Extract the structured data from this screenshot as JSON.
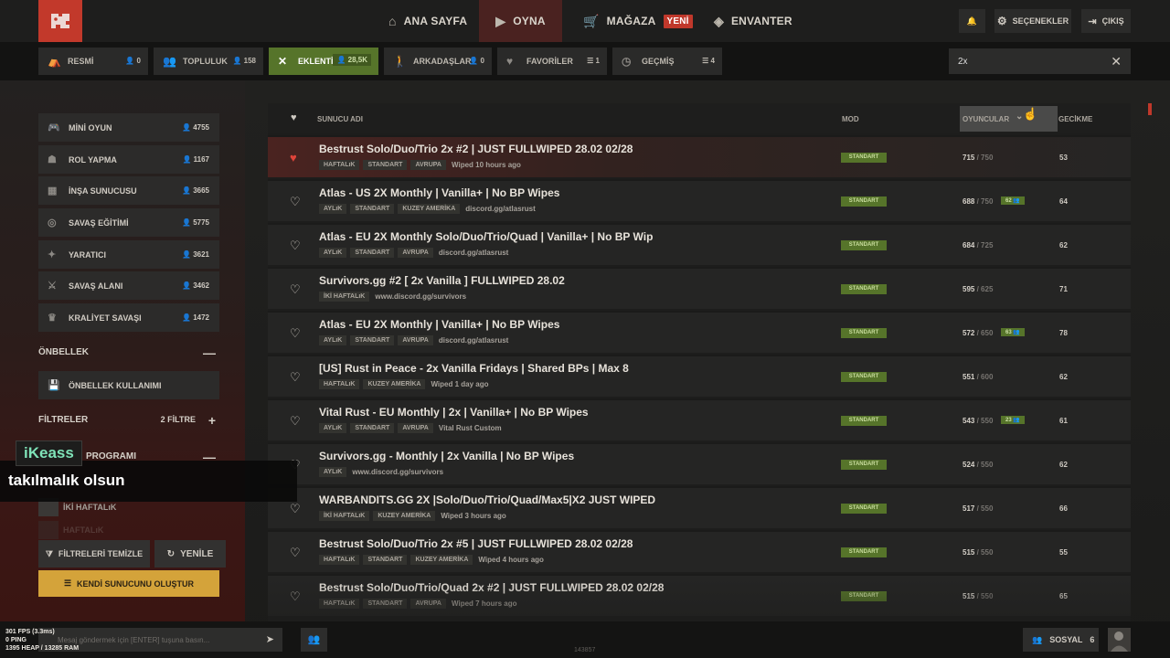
{
  "nav": {
    "home": "ANA SAYFA",
    "play": "OYNA",
    "store": "MAĞAZA",
    "store_badge": "YENİ",
    "inventory": "ENVANTER",
    "options": "SEÇENEKLER",
    "quit": "ÇIKIŞ"
  },
  "tabs": [
    {
      "label": "RESMİ",
      "count": "0",
      "icon": "official-icon"
    },
    {
      "label": "TOPLULUK",
      "count": "158",
      "icon": "community-icon"
    },
    {
      "label": "EKLENTİLİ",
      "count": "28,5K",
      "icon": "modded-icon"
    },
    {
      "label": "ARKADAŞLAR",
      "count": "0",
      "icon": "friends-icon"
    },
    {
      "label": "FAVORİLER",
      "count": "1",
      "icon": "heart-icon"
    },
    {
      "label": "GEÇMİŞ",
      "count": "4",
      "icon": "history-icon"
    }
  ],
  "search": {
    "value": "2x"
  },
  "gamemodes": [
    {
      "label": "MİNİ OYUN",
      "count": "4755"
    },
    {
      "label": "ROL YAPMA",
      "count": "1167"
    },
    {
      "label": "İNŞA SUNUCUSU",
      "count": "3665"
    },
    {
      "label": "SAVAŞ EĞİTİMİ",
      "count": "5775"
    },
    {
      "label": "YARATICI",
      "count": "3621"
    },
    {
      "label": "SAVAŞ ALANI",
      "count": "3462"
    },
    {
      "label": "KRALİYET SAVAŞI",
      "count": "1472"
    }
  ],
  "cache": {
    "title": "ÖNBELLEK",
    "button": "ÖNBELLEK KULLANIMI"
  },
  "filters": {
    "title": "FİLTRELER",
    "count": "2 FİLTRE",
    "wipe_title": "PROGRAMI",
    "opt1": "İKİ HAFTALıK",
    "opt2": "HAFTALıK"
  },
  "actions": {
    "clear": "FİLTRELERİ TEMİZLE",
    "refresh": "YENİLE",
    "create": "KENDİ SUNUCUNU OLUŞTUR"
  },
  "columns": {
    "name": "SUNUCU ADI",
    "mode": "MOD",
    "players": "OYUNCULAR",
    "ping": "GECİKME"
  },
  "servers": [
    {
      "name": "Bestrust Solo/Duo/Trio 2x #2 | JUST FULLWIPED 28.02 02/28",
      "tags": [
        "HAFTALıK",
        "STANDART",
        "AVRUPA"
      ],
      "extra": "Wiped 10 hours ago",
      "mode": "STANDART",
      "players": "715",
      "max": "/ 750",
      "queue": "",
      "ping": "53",
      "fav": true
    },
    {
      "name": "Atlas - US 2X Monthly | Vanilla+ | No BP Wipes",
      "tags": [
        "AYLıK",
        "STANDART",
        "KUZEY AMERİKA"
      ],
      "extra": "discord.gg/atlasrust",
      "mode": "STANDART",
      "players": "688",
      "max": "/ 750",
      "queue": "62",
      "ping": "64",
      "fav": false
    },
    {
      "name": "Atlas - EU 2X Monthly Solo/Duo/Trio/Quad | Vanilla+ | No BP Wip",
      "tags": [
        "AYLıK",
        "STANDART",
        "AVRUPA"
      ],
      "extra": "discord.gg/atlasrust",
      "mode": "STANDART",
      "players": "684",
      "max": "/ 725",
      "queue": "",
      "ping": "62",
      "fav": false
    },
    {
      "name": "Survivors.gg #2 [ 2x Vanilla ] FULLWIPED 28.02",
      "tags": [
        "İKİ HAFTALıK"
      ],
      "extra": "www.discord.gg/survivors",
      "mode": "STANDART",
      "players": "595",
      "max": "/ 625",
      "queue": "",
      "ping": "71",
      "fav": false
    },
    {
      "name": "Atlas - EU 2X Monthly | Vanilla+ | No BP Wipes",
      "tags": [
        "AYLıK",
        "STANDART",
        "AVRUPA"
      ],
      "extra": "discord.gg/atlasrust",
      "mode": "STANDART",
      "players": "572",
      "max": "/ 650",
      "queue": "63",
      "ping": "78",
      "fav": false
    },
    {
      "name": "[US] Rust in Peace - 2x Vanilla Fridays | Shared BPs | Max 8",
      "tags": [
        "HAFTALıK",
        "KUZEY AMERİKA"
      ],
      "extra": "Wiped 1 day ago",
      "mode": "STANDART",
      "players": "551",
      "max": "/ 600",
      "queue": "",
      "ping": "62",
      "fav": false
    },
    {
      "name": "Vital Rust - EU Monthly | 2x | Vanilla+ | No BP Wipes",
      "tags": [
        "AYLıK",
        "STANDART",
        "AVRUPA"
      ],
      "extra": "Vital Rust Custom",
      "mode": "STANDART",
      "players": "543",
      "max": "/ 550",
      "queue": "23",
      "ping": "61",
      "fav": false
    },
    {
      "name": "Survivors.gg - Monthly | 2x Vanilla | No BP Wipes",
      "tags": [
        "AYLıK"
      ],
      "extra": "www.discord.gg/survivors",
      "mode": "STANDART",
      "players": "524",
      "max": "/ 550",
      "queue": "",
      "ping": "62",
      "fav": false
    },
    {
      "name": "WARBANDITS.GG 2X |Solo/Duo/Trio/Quad/Max5|X2 JUST WIPED",
      "tags": [
        "İKİ HAFTALıK",
        "KUZEY AMERİKA"
      ],
      "extra": "Wiped 3 hours ago",
      "mode": "STANDART",
      "players": "517",
      "max": "/ 550",
      "queue": "",
      "ping": "66",
      "fav": false
    },
    {
      "name": "Bestrust Solo/Duo/Trio 2x #5 | JUST FULLWIPED 28.02 02/28",
      "tags": [
        "HAFTALıK",
        "STANDART",
        "KUZEY AMERİKA"
      ],
      "extra": "Wiped 4 hours ago",
      "mode": "STANDART",
      "players": "515",
      "max": "/ 550",
      "queue": "",
      "ping": "55",
      "fav": false
    },
    {
      "name": "Bestrust Solo/Duo/Trio/Quad 2x #2 | JUST FULLWIPED 28.02 02/28",
      "tags": [
        "HAFTALıK",
        "STANDART",
        "AVRUPA"
      ],
      "extra": "Wiped 7 hours ago",
      "mode": "STANDART",
      "players": "515",
      "max": "/ 550",
      "queue": "",
      "ping": "65",
      "fav": false
    }
  ],
  "bottom": {
    "fps": "301 FPS (3.3ms)",
    "ping": "0 PING",
    "mem": "1395 HEAP / 13285 RAM",
    "chat_placeholder": "Mesaj göndermek için [ENTER] tuşuna basın...",
    "social": "SOSYAL",
    "social_count": "6",
    "build": "143857"
  },
  "overlay": {
    "user": "iKeass",
    "message": "takılmalık olsun"
  },
  "colors": {
    "accent_red": "#c0382b",
    "accent_green": "#56742a",
    "create_button": "#d4a33a"
  }
}
